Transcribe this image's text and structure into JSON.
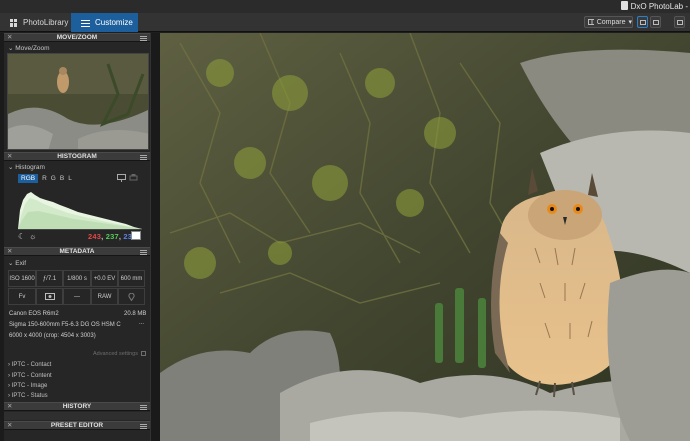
{
  "app": {
    "title": "DxO PhotoLab -"
  },
  "tabs": [
    {
      "label": "PhotoLibrary",
      "icon": "grid-icon",
      "active": false
    },
    {
      "label": "Customize",
      "icon": "sliders-icon",
      "active": true
    }
  ],
  "toolbar": {
    "compare_label": "Compare"
  },
  "panels": {
    "move_zoom": {
      "title": "MOVE/ZOOM",
      "sub": "Move/Zoom"
    },
    "histogram": {
      "title": "HISTOGRAM",
      "sub": "Histogram",
      "channels": [
        "RGB",
        "R",
        "G",
        "B",
        "L"
      ],
      "values": {
        "r": "243",
        "g": "237",
        "b": "237"
      },
      "colors": {
        "r": "#e04848",
        "g": "#58c858",
        "b": "#5a82e6"
      }
    },
    "metadata": {
      "title": "METADATA",
      "exif_label": "Exif",
      "exif_cells": [
        "ISO 1600",
        "ƒ/7.1",
        "1/800 s",
        "+0.0 EV",
        "600 mm"
      ],
      "exif_row2": [
        "Fv",
        "",
        "—",
        "RAW",
        ""
      ],
      "camera": "Canon EOS R6m2",
      "file_size": "20.8 MB",
      "lens": "Sigma 150-600mm F5-6.3 DG OS HSM C",
      "lens_more": "...",
      "dimensions": "6000 x 4000  (crop: 4504 x 3003)",
      "advanced": "Advanced settings",
      "iptc": [
        "IPTC - Contact",
        "IPTC - Content",
        "IPTC - Image",
        "IPTC - Status"
      ]
    },
    "history": {
      "title": "HISTORY"
    },
    "preset_editor": {
      "title": "PRESET EDITOR"
    }
  }
}
